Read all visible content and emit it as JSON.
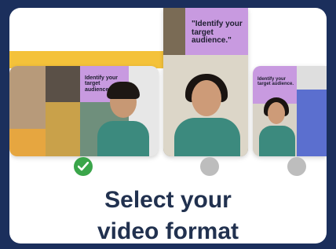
{
  "format_options": [
    {
      "caption": "Identify your target audience.",
      "selected": true
    },
    {
      "caption": "\"Identify your target audience.\"",
      "selected": false
    },
    {
      "caption": "Identify your target audience.",
      "selected": false
    }
  ],
  "title_line1": "Select your",
  "title_line2": "video format",
  "colors": {
    "background": "#1b2f5c",
    "card": "#ffffff",
    "accent_yellow": "#f4c23a",
    "purple_panel": "#c89ae0",
    "selected_radio": "#3aa54a",
    "unselected_radio": "#bdbdbd",
    "title": "#21314f"
  },
  "icons": {
    "selected_radio": "check-icon"
  }
}
